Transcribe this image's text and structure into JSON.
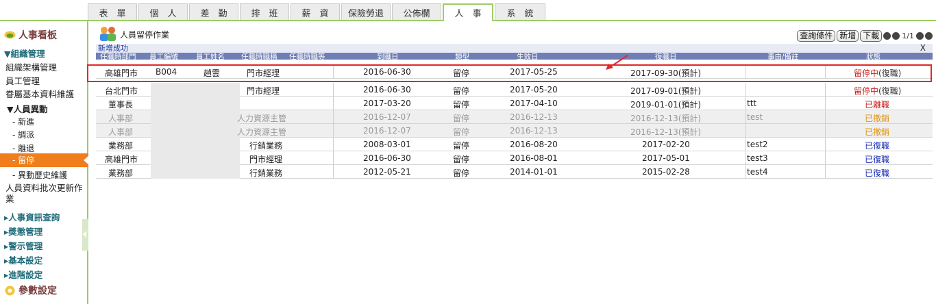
{
  "tabs": [
    "表　單",
    "個　人",
    "差　勤",
    "排　班",
    "薪　資",
    "保險勞退",
    "公佈欄",
    "人　事",
    "系　統"
  ],
  "sidebar": {
    "header_top": "人事看板",
    "section_org": "▼組織管理",
    "org_items": [
      "組織架構管理",
      "員工管理",
      "眷屬基本資料維護"
    ],
    "sub_change": "▼人員異動",
    "change_items": [
      "- 新進",
      "- 調派",
      "- 離退"
    ],
    "active_item": "- 留停",
    "change_history": "- 異動歷史維護",
    "batch_update": "人員資料批次更新作業",
    "sections": [
      "▸人事資訊查詢",
      "▸獎懲管理",
      "▸警示管理",
      "▸基本設定",
      "▸進階設定"
    ],
    "header_bottom": "參數設定"
  },
  "main": {
    "title": "人員留停作業",
    "buttons": {
      "query": "查詢條件",
      "add": "新增",
      "download": "下載"
    },
    "pager": "1/1",
    "message": "新增成功",
    "close": "X",
    "columns": [
      "任職時部門",
      "員工編號",
      "員工姓名",
      "任職時職稱",
      "任職時職等",
      "到職日",
      "類型",
      "生效日",
      "復職日",
      "事由/備註",
      "狀態"
    ],
    "rows": [
      {
        "dept": "高雄門市",
        "emp_id": "B004",
        "name": "趙雲",
        "title": "門市經理",
        "hire": "2016-06-30",
        "type": "留停",
        "effective": "2017-05-25",
        "return": "2017-09-30(預計)",
        "note": "",
        "status": "留停中",
        "status_action": "(復職)"
      },
      {
        "dept": "台北門市",
        "emp_id": "",
        "name": "",
        "title": "門市經理",
        "hire": "2016-06-30",
        "type": "留停",
        "effective": "2017-05-20",
        "return": "2017-09-01(預計)",
        "note": "",
        "status": "留停中",
        "status_action": "(復職)"
      },
      {
        "dept": "董事長",
        "emp_id": "",
        "name": "",
        "title": "",
        "hire": "2017-03-20",
        "type": "留停",
        "effective": "2017-04-10",
        "return": "2019-01-01(預計)",
        "note": "ttt",
        "status": "已離職",
        "status_action": ""
      },
      {
        "dept": "人事部",
        "emp_id": "",
        "name": "",
        "title": "人力資源主管",
        "hire": "2016-12-07",
        "type": "留停",
        "effective": "2016-12-13",
        "return": "2016-12-13(預計)",
        "note": "test",
        "status": "已撤銷",
        "status_action": ""
      },
      {
        "dept": "人事部",
        "emp_id": "",
        "name": "",
        "title": "人力資源主管",
        "hire": "2016-12-07",
        "type": "留停",
        "effective": "2016-12-13",
        "return": "2016-12-13(預計)",
        "note": "",
        "status": "已撤銷",
        "status_action": ""
      },
      {
        "dept": "業務部",
        "emp_id": "",
        "name": "",
        "title": "行銷業務",
        "hire": "2008-03-01",
        "type": "留停",
        "effective": "2016-08-20",
        "return": "2017-02-20",
        "note": "test2",
        "status": "已復職",
        "status_action": ""
      },
      {
        "dept": "高雄門市",
        "emp_id": "",
        "name": "",
        "title": "門市經理",
        "hire": "2016-06-30",
        "type": "留停",
        "effective": "2016-08-01",
        "return": "2017-05-01",
        "note": "test3",
        "status": "已復職",
        "status_action": ""
      },
      {
        "dept": "業務部",
        "emp_id": "",
        "name": "",
        "title": "行銷業務",
        "hire": "2012-05-21",
        "type": "留停",
        "effective": "2014-01-01",
        "return": "2015-02-28",
        "note": "test4",
        "status": "已復職",
        "status_action": ""
      }
    ]
  },
  "colors": {
    "accent": "#9ccc65",
    "active": "#f07e1c",
    "header": "#6f7fb5",
    "highlight": "#e02828"
  }
}
